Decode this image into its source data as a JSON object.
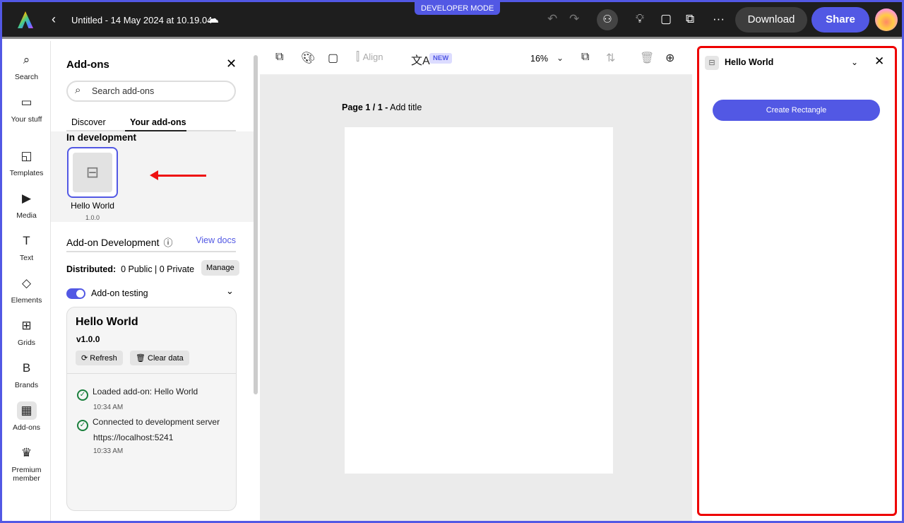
{
  "topbar": {
    "dev_mode": "DEVELOPER MODE",
    "title": "Untitled - 14 May 2024 at 10.19.04",
    "download": "Download",
    "share": "Share"
  },
  "rail": [
    {
      "label": "Search",
      "icon": "⌕"
    },
    {
      "label": "Your stuff",
      "icon": "▭"
    },
    {
      "label": "Templates",
      "icon": "◱"
    },
    {
      "label": "Media",
      "icon": "▶"
    },
    {
      "label": "Text",
      "icon": "T"
    },
    {
      "label": "Elements",
      "icon": "◇"
    },
    {
      "label": "Grids",
      "icon": "⊞"
    },
    {
      "label": "Brands",
      "icon": "B"
    },
    {
      "label": "Add-ons",
      "icon": "▦"
    },
    {
      "label": "Premium",
      "label2": "member",
      "icon": "♛"
    }
  ],
  "panel": {
    "title": "Add-ons",
    "search_placeholder": "Search add-ons",
    "tabs": [
      "Discover",
      "Your add-ons"
    ],
    "in_development": "In development",
    "addon_name": "Hello World",
    "addon_version": "1.0.0",
    "dev": {
      "title": "Add-on Development",
      "view_docs": "View docs",
      "distributed_label": "Distributed:",
      "distributed_value": "0 Public | 0 Private",
      "manage": "Manage",
      "testing": "Add-on testing",
      "testing_on": true,
      "card": {
        "name": "Hello World",
        "version": "v1.0.0",
        "refresh": "Refresh",
        "clear": "Clear data",
        "logs": [
          {
            "msg": "Loaded add-on: Hello World",
            "time": "10:34 AM"
          },
          {
            "msg": "Connected to development server",
            "url": "https://localhost:5241",
            "time": "10:33 AM"
          }
        ]
      }
    }
  },
  "canvas": {
    "align": "Align",
    "new_badge": "NEW",
    "zoom": "16%",
    "page_label": "Page 1 / 1 -",
    "add_title": "Add title"
  },
  "right_panel": {
    "title": "Hello World",
    "button": "Create Rectangle"
  },
  "colors": {
    "accent": "#5258e4",
    "highlight": "#e00000",
    "success": "#1a7f3c"
  }
}
